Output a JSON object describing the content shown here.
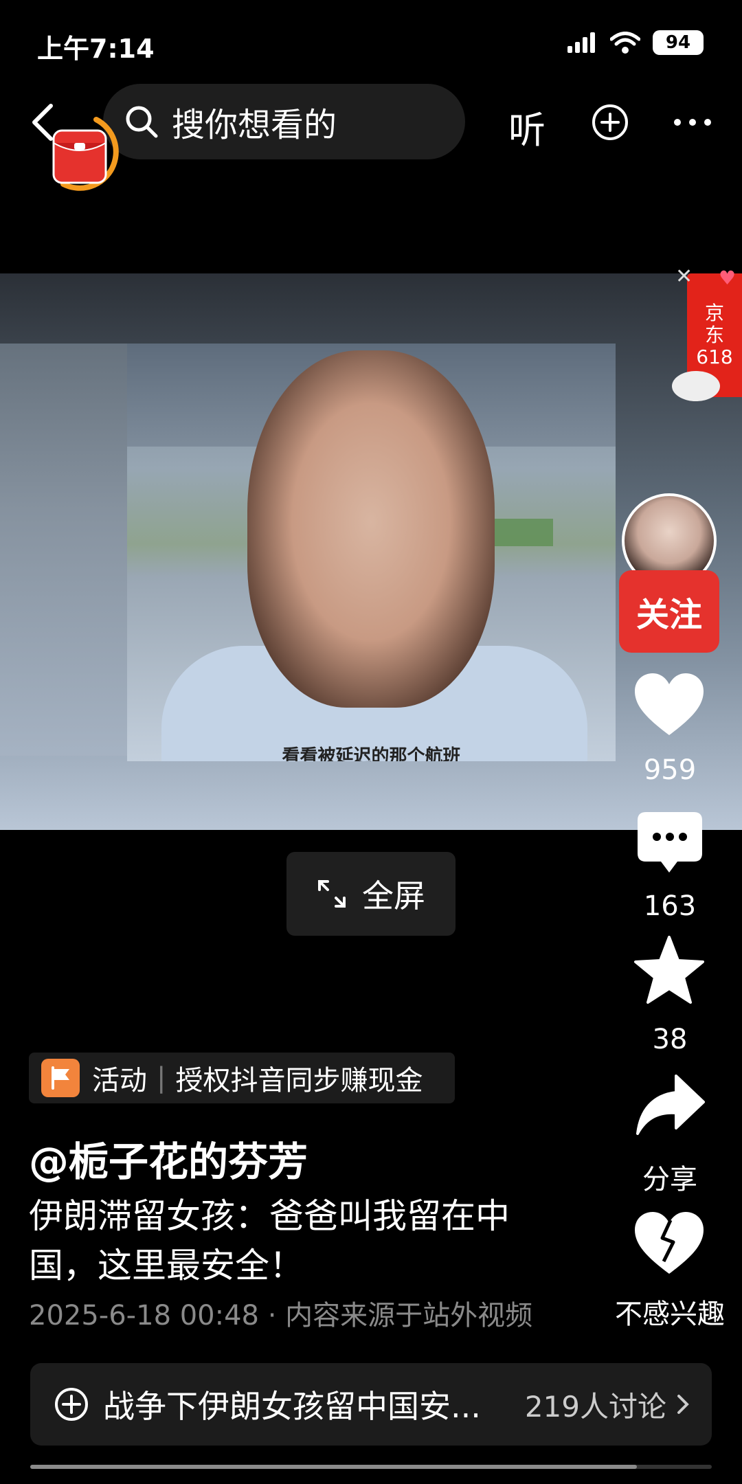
{
  "status_bar": {
    "time": "上午7:14",
    "battery": "94"
  },
  "nav": {
    "search_placeholder": "搜你想看的",
    "listen_label": "听"
  },
  "video": {
    "subtitle": "看看被延迟的那个航班",
    "playback_progress": 0.89
  },
  "promo_badge": {
    "line1": "京",
    "line2": "东",
    "line3": "618"
  },
  "rail": {
    "follow_label": "关注",
    "likes": "959",
    "comments": "163",
    "favorites": "38",
    "share_label": "分享",
    "dislike_label": "不感兴趣"
  },
  "fullscreen_label": "全屏",
  "activity": {
    "tag": "活动",
    "text": "授权抖音同步赚现金"
  },
  "post": {
    "author": "@栀子花的芬芳",
    "caption": "伊朗滞留女孩：爸爸叫我留在中国，这里最安全！",
    "meta": "2025-6-18 00:48 · 内容来源于站外视频"
  },
  "topic": {
    "text": "战争下伊朗女孩留中国安...",
    "count": "219人讨论"
  },
  "colors": {
    "accent_red": "#e5322d",
    "activity_orange": "#f2843c",
    "background": "#000000"
  }
}
